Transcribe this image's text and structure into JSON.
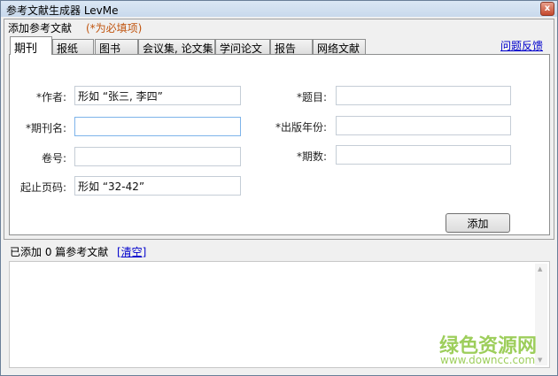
{
  "window": {
    "title": "参考文献生成器   LevMe",
    "close": "x"
  },
  "group": {
    "label": "添加参考文献",
    "required_note": "(*为必填项)"
  },
  "tabs": [
    "期刊",
    "报纸",
    "图书",
    "会议集, 论文集",
    "学问论文",
    "报告",
    "网络文献"
  ],
  "feedback_link": "问题反馈",
  "form": {
    "author": {
      "label": "*作者:",
      "value": "形如 “张三, 李四”"
    },
    "journal": {
      "label": "*期刊名:",
      "value": ""
    },
    "volume": {
      "label": "卷号:",
      "value": ""
    },
    "pages": {
      "label": "起止页码:",
      "value": "形如 “32-42”"
    },
    "title": {
      "label": "*题目:",
      "value": ""
    },
    "year": {
      "label": "*出版年份:",
      "value": ""
    },
    "issue": {
      "label": "*期数:",
      "value": ""
    }
  },
  "add_button": "添加",
  "status": {
    "text": "已添加 0 篇参考文献",
    "clear_link": "[清空]"
  },
  "watermark": {
    "line1": "绿色资源网",
    "line2": "www.downcc.com"
  }
}
